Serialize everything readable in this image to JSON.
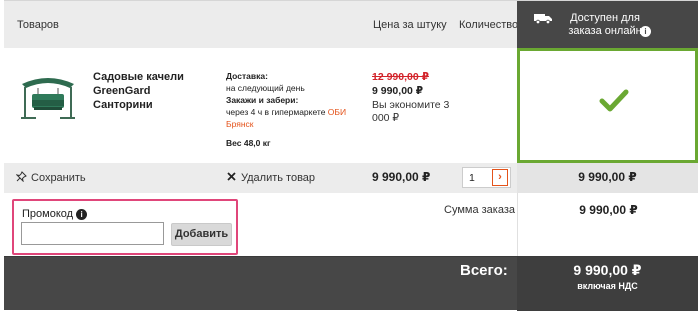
{
  "header": {
    "products_label": "Товаров",
    "price_label": "Цена за штуку",
    "quantity_label": "Количество",
    "online_label": "Доступен для заказа онлайн",
    "info_glyph": "i"
  },
  "product": {
    "name": "Садовые качели GreenGard Санторини",
    "delivery_title": "Доставка:",
    "delivery_text": "на следующий день",
    "pickup_title": "Закажи и забери:",
    "pickup_text": "через 4 ч в гипермаркете ",
    "pickup_store": "ОБИ Брянск",
    "weight": "Вес 48,0 кг",
    "old_price": "12 990,00 ₽",
    "price": "9 990,00 ₽",
    "savings": "Вы экономите 3 000 ₽",
    "available_online": true,
    "status_color": "#6aa832"
  },
  "actions": {
    "save_label": "Сохранить",
    "save_icon": "pin-icon",
    "remove_label": "Удалить товар",
    "remove_icon": "close-icon",
    "row_total": "9 990,00 ₽",
    "quantity": "1",
    "qty_arrow": "›",
    "right_total": "9 990,00 ₽"
  },
  "promo": {
    "label": "Промокод",
    "input_value": "",
    "button_label": "Добавить",
    "sum_label": "Сумма заказа",
    "sum_value": "9 990,00 ₽"
  },
  "total": {
    "label": "Всего:",
    "amount": "9 990,00 ₽",
    "vat_note": "включая НДС"
  },
  "colors": {
    "accent": "#e4531b",
    "available": "#6aa832",
    "promo_border": "#e0467a",
    "dark": "#474747"
  }
}
